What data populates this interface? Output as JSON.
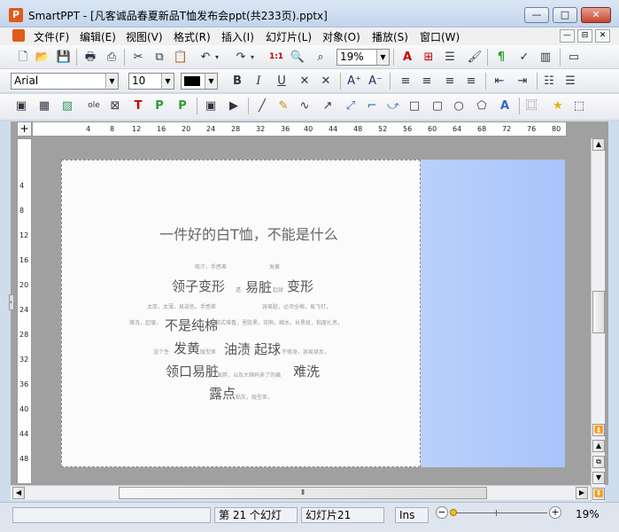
{
  "window": {
    "title": "SmartPPT - [凡客诚品春夏新品T恤发布会ppt(共233页).pptx]",
    "app_icon": "P",
    "minimize": "—",
    "maximize": "□",
    "close": "✕"
  },
  "menu": [
    "文件(F)",
    "编辑(E)",
    "视图(V)",
    "格式(R)",
    "插入(I)",
    "幻灯片(L)",
    "对象(O)",
    "播放(S)",
    "窗口(W)"
  ],
  "mdi_controls": [
    "—",
    "⊟",
    "✕"
  ],
  "toolbar1": {
    "zoom_value": "19%",
    "icons": [
      "new-icon",
      "open-icon",
      "save-icon",
      "print-icon",
      "pdf-icon",
      "cut-icon",
      "copy-icon",
      "paste-icon",
      "undo-icon",
      "redo-icon",
      "fullsize-icon",
      "zoom-icon",
      "find-icon",
      "text-color-icon",
      "insert-icon",
      "notes-icon",
      "brush-icon",
      "format-icon",
      "spell-icon",
      "chart-icon",
      "slide-icon"
    ]
  },
  "toolbar2": {
    "font_name": "Arial",
    "font_size": "10",
    "color": "#000000"
  },
  "toolbar3": {
    "icons": [
      "layout-icon",
      "table-icon",
      "image-icon",
      "ole-icon",
      "placeholder-icon",
      "title-icon",
      "picture-icon",
      "textbox-icon",
      "slide-icon",
      "video-icon",
      "line-icon",
      "pen-icon",
      "curve-icon",
      "arrow-icon",
      "connector-icon",
      "elbow-icon",
      "curved-connector-icon",
      "rectangle-icon",
      "rounded-rect-icon",
      "ellipse-icon",
      "shape-icon",
      "text-art-icon",
      "group-icon",
      "star-icon",
      "select-icon"
    ]
  },
  "hruler": [
    "4",
    "8",
    "12",
    "16",
    "20",
    "24",
    "28",
    "32",
    "36",
    "40",
    "44",
    "48",
    "52",
    "56",
    "60",
    "64",
    "68",
    "72",
    "76",
    "80"
  ],
  "vruler": [
    "4",
    "8",
    "12",
    "16",
    "20",
    "24",
    "28",
    "32",
    "36",
    "40",
    "44",
    "48"
  ],
  "slide": {
    "heading": "一件好的白T恤，不能是什么",
    "words": {
      "w1": "吸汗，手感差",
      "w2": "发黄",
      "w3": "领子变形",
      "w4": "透",
      "w5": "易脏",
      "w6": "起球",
      "w7": "变形",
      "w8": "太厚，太薄，易染色，手感差",
      "w9": "容易脏，必须全棉，易飞打，",
      "w10": "难洗，起皱，",
      "w11": "不是纯棉",
      "w12": "款式难看，里胶黑，花哨，缩水，长黑斑，粘度扎亮，",
      "w13": "没个性",
      "w14": "发黄",
      "w15": "版型差",
      "w16": "油渍",
      "w17": "起球",
      "w18": "不修身，容易穿反，",
      "w19": "领口易脏",
      "w20": "显胖，以及大姨妈来了的痛",
      "w21": "难洗",
      "w22": "露点",
      "w23": "粘灰，版型差，"
    }
  },
  "status": {
    "slide_count": "第 21 个幻灯",
    "slide_name": "幻灯片21",
    "mode": "Ins",
    "zoom": "19%"
  }
}
